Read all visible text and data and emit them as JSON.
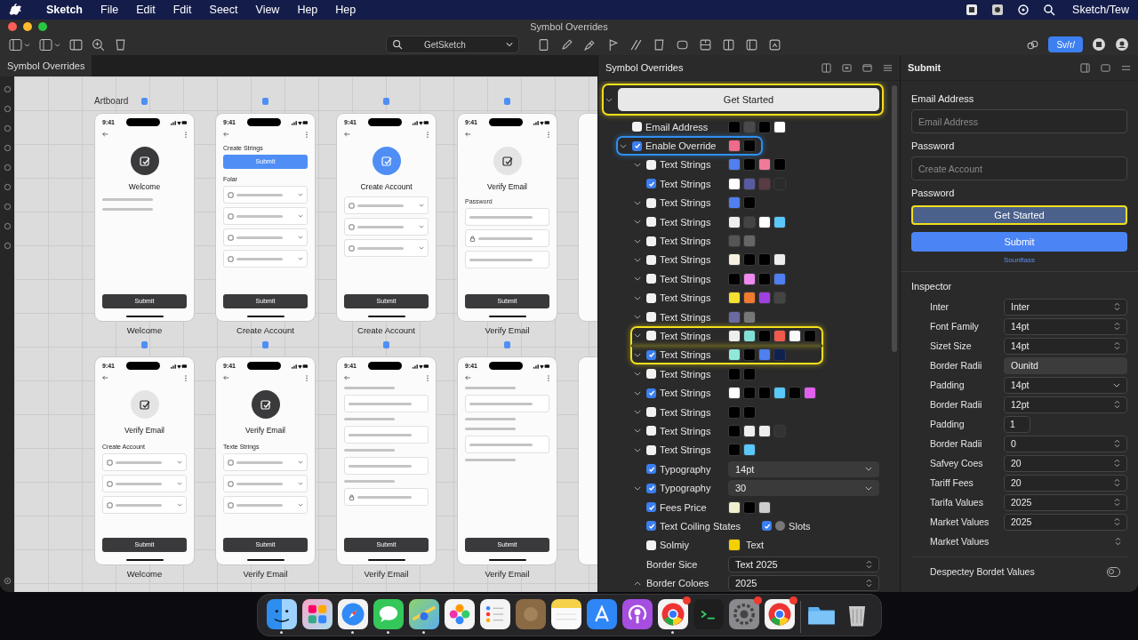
{
  "menubar": {
    "app": "Sketch",
    "menus": [
      "File",
      "Edit",
      "Fdit",
      "Seect",
      "View",
      "Hep",
      "Hep"
    ],
    "status_text": "Sketch/Tew"
  },
  "window": {
    "title": "Symbol Overrides",
    "search": {
      "value": "GetSketch"
    },
    "toolbar_button": "Sv/r/"
  },
  "canvas": {
    "tab": "Symbol Overrides",
    "artboard_label": "Artboard",
    "rows": [
      [
        {
          "caption": "Welcome",
          "time": "9:41",
          "blocks": [
            {
              "kind": "avatar",
              "color": "#3a3a3c"
            },
            {
              "kind": "title",
              "text": "Welcome"
            },
            {
              "kind": "scribble"
            },
            {
              "kind": "scribble"
            },
            {
              "kind": "button",
              "text": "Submit"
            }
          ]
        },
        {
          "caption": "Create Account",
          "time": "9:41",
          "blocks": [
            {
              "kind": "heading",
              "text": "Create Strings"
            },
            {
              "kind": "primary",
              "text": "Submit"
            },
            {
              "kind": "heading",
              "text": "Folar"
            },
            {
              "kind": "select"
            },
            {
              "kind": "select"
            },
            {
              "kind": "select"
            },
            {
              "kind": "select"
            },
            {
              "kind": "button",
              "text": "Submit"
            }
          ]
        },
        {
          "caption": "Create Account",
          "time": "9:41",
          "blocks": [
            {
              "kind": "avatar",
              "color": "#4f8ff5"
            },
            {
              "kind": "title",
              "text": "Create Account"
            },
            {
              "kind": "select"
            },
            {
              "kind": "select"
            },
            {
              "kind": "select"
            },
            {
              "kind": "button",
              "text": "Submit"
            }
          ]
        },
        {
          "caption": "Verify Email",
          "time": "9:41",
          "blocks": [
            {
              "kind": "avatar",
              "color": "#e4e4e4"
            },
            {
              "kind": "title",
              "text": "Verify Email"
            },
            {
              "kind": "label",
              "text": "Password"
            },
            {
              "kind": "field",
              "icon": false
            },
            {
              "kind": "field",
              "icon": true
            },
            {
              "kind": "field",
              "icon": false
            },
            {
              "kind": "button",
              "text": "Submit"
            }
          ]
        }
      ],
      [
        {
          "caption": "Welcome",
          "time": "9:41",
          "blocks": [
            {
              "kind": "avatar",
              "color": "#e4e4e4"
            },
            {
              "kind": "title",
              "text": "Verify Email"
            },
            {
              "kind": "heading",
              "text": "Create Account"
            },
            {
              "kind": "select"
            },
            {
              "kind": "select"
            },
            {
              "kind": "select"
            },
            {
              "kind": "button",
              "text": "Submit"
            }
          ]
        },
        {
          "caption": "Verify Email",
          "time": "9:41",
          "blocks": [
            {
              "kind": "avatar",
              "color": "#3a3a3c"
            },
            {
              "kind": "title",
              "text": "Verify Email"
            },
            {
              "kind": "heading",
              "text": "Texte Strings"
            },
            {
              "kind": "select"
            },
            {
              "kind": "select"
            },
            {
              "kind": "select"
            },
            {
              "kind": "button",
              "text": "Submit"
            }
          ]
        },
        {
          "caption": "Verify Email",
          "time": "9:41",
          "blocks": [
            {
              "kind": "scribble"
            },
            {
              "kind": "field",
              "icon": false
            },
            {
              "kind": "scribble"
            },
            {
              "kind": "field",
              "icon": false
            },
            {
              "kind": "scribble"
            },
            {
              "kind": "field",
              "icon": false
            },
            {
              "kind": "scribble"
            },
            {
              "kind": "field",
              "icon": true
            },
            {
              "kind": "button",
              "text": "Submit"
            }
          ]
        },
        {
          "caption": "Verify Email",
          "time": "9:41",
          "blocks": [
            {
              "kind": "scribble"
            },
            {
              "kind": "field",
              "icon": false
            },
            {
              "kind": "scribble"
            },
            {
              "kind": "scribble"
            },
            {
              "kind": "field",
              "icon": false
            },
            {
              "kind": "scribble"
            },
            {
              "kind": "button",
              "text": "Submit"
            }
          ]
        }
      ]
    ]
  },
  "overrides": {
    "title": "Symbol Overrides",
    "items": [
      {
        "kind": "button",
        "label": "Get Started",
        "expanded": true,
        "highlight": {
          "color": "#f2df1c"
        },
        "children": [
          {
            "kind": "swatches",
            "label": "Email Address",
            "checked": false,
            "swatches": [
              {
                "color": "#000000"
              },
              {
                "color": "#4a4a4a"
              },
              {
                "color": "#000000"
              },
              {
                "color": "#ffffff"
              }
            ]
          },
          {
            "kind": "swatches",
            "label": "Enable Override",
            "checked": true,
            "expanded": true,
            "highlight": {
              "color": "#2f8ff0"
            },
            "swatches": [
              {
                "color": "#f06a8a"
              },
              {
                "color": "#000000"
              }
            ],
            "children": [
              {
                "kind": "swatches",
                "label": "Text Strings",
                "checked": false,
                "expanded": true,
                "swatches": [
                  {
                    "color": "#4f7ff0"
                  },
                  {
                    "color": "#000000"
                  },
                  {
                    "color": "#f07a9a"
                  },
                  {
                    "color": "#000000"
                  }
                ]
              },
              {
                "kind": "swatches",
                "label": "Text Strings",
                "checked": true,
                "swatches": [
                  {
                    "color": "#ffffff"
                  },
                  {
                    "color": "#5a5aa0"
                  },
                  {
                    "color": "#5a3a44"
                  },
                  {
                    "color": "#2a2a2a"
                  }
                ]
              },
              {
                "kind": "swatches",
                "label": "Text Strings",
                "checked": false,
                "expanded": true,
                "swatches": [
                  {
                    "color": "#4f7ff0"
                  },
                  {
                    "color": "#000000"
                  }
                ]
              },
              {
                "kind": "swatches",
                "label": "Text Strings",
                "checked": false,
                "expanded": true,
                "swatches": [
                  {
                    "color": "#eeeeee"
                  },
                  {
                    "color": "#444444"
                  },
                  {
                    "color": "#ffffff"
                  },
                  {
                    "color": "#5ac8fa"
                  }
                ]
              },
              {
                "kind": "swatches",
                "label": "Text Strings",
                "checked": false,
                "expanded": true,
                "swatches": [
                  {
                    "color": "#555555"
                  },
                  {
                    "color": "#666666"
                  }
                ]
              },
              {
                "kind": "swatches",
                "label": "Text Strings",
                "checked": false,
                "expanded": true,
                "swatches": [
                  {
                    "color": "#f5f0e0"
                  },
                  {
                    "color": "#000000"
                  },
                  {
                    "color": "#000000"
                  },
                  {
                    "color": "#eeeeee"
                  }
                ]
              },
              {
                "kind": "swatches",
                "label": "Text Strings",
                "checked": false,
                "expanded": true,
                "swatches": [
                  {
                    "color": "#000000"
                  },
                  {
                    "color": "#f08af0"
                  },
                  {
                    "color": "#000000"
                  },
                  {
                    "color": "#4f7ff0"
                  }
                ]
              },
              {
                "kind": "swatches",
                "label": "Text Strings",
                "checked": false,
                "expanded": true,
                "swatches": [
                  {
                    "color": "#f5e030"
                  },
                  {
                    "color": "#f07a30"
                  },
                  {
                    "color": "#a040e0"
                  },
                  {
                    "color": "#444444"
                  }
                ]
              },
              {
                "kind": "swatches",
                "label": "Text Strings",
                "checked": false,
                "expanded": true,
                "swatches": [
                  {
                    "color": "#6a6aa0"
                  },
                  {
                    "color": "#777777"
                  }
                ]
              },
              {
                "kind": "swatches",
                "label": "Text Strings",
                "checked": false,
                "expanded": true,
                "highlight": {
                  "color": "#f2df1c"
                },
                "swatches": [
                  {
                    "color": "#eeeeee"
                  },
                  {
                    "color": "#80e0d8"
                  },
                  {
                    "color": "#000000"
                  },
                  {
                    "color": "#f05a4a"
                  },
                  {
                    "color": "#fafafa"
                  },
                  {
                    "color": "#000000"
                  }
                ]
              },
              {
                "kind": "swatches",
                "label": "Text Strings",
                "checked": true,
                "expanded": true,
                "highlight": {
                  "color": "#f2df1c"
                },
                "swatches": [
                  {
                    "color": "#90e8d8"
                  },
                  {
                    "color": "#000000"
                  },
                  {
                    "color": "#4f7ff0"
                  },
                  {
                    "color": "#102050"
                  }
                ]
              },
              {
                "kind": "swatches",
                "label": "Text Strings",
                "checked": false,
                "expanded": true,
                "swatches": [
                  {
                    "color": "#000000"
                  },
                  {
                    "color": "#000000"
                  }
                ]
              },
              {
                "kind": "swatches",
                "label": "Text Strings",
                "checked": true,
                "expanded": true,
                "swatches": [
                  {
                    "color": "#ffffff"
                  },
                  {
                    "color": "#000000"
                  },
                  {
                    "color": "#000000"
                  },
                  {
                    "color": "#5ac8fa"
                  },
                  {
                    "color": "#000000"
                  },
                  {
                    "color": "#e060f0"
                  }
                ]
              },
              {
                "kind": "swatches",
                "label": "Text Strings",
                "checked": false,
                "expanded": true,
                "swatches": [
                  {
                    "color": "#000000"
                  },
                  {
                    "color": "#000000"
                  }
                ]
              },
              {
                "kind": "swatches",
                "label": "Text Strings",
                "checked": false,
                "expanded": true,
                "swatches": [
                  {
                    "color": "#000000"
                  },
                  {
                    "color": "#eeeeee"
                  },
                  {
                    "color": "#eeeeee"
                  },
                  {
                    "color": "#333333"
                  }
                ]
              },
              {
                "kind": "swatches",
                "label": "Text Strings",
                "checked": false,
                "expanded": true,
                "swatches": [
                  {
                    "color": "#000000"
                  },
                  {
                    "color": "#5ac8fa"
                  }
                ]
              },
              {
                "kind": "select",
                "label": "Typography",
                "checked": true,
                "value": "14pt"
              },
              {
                "kind": "select",
                "label": "Typography",
                "checked": true,
                "expanded": true,
                "value": "30"
              },
              {
                "kind": "swatches",
                "label": "Fees Price",
                "checked": true,
                "swatches": [
                  {
                    "color": "#f0f0d0"
                  },
                  {
                    "color": "#000000"
                  },
                  {
                    "color": "#cccccc"
                  }
                ]
              },
              {
                "kind": "double",
                "label": "Text Coiling States",
                "checked": true,
                "second": {
                  "label": "Slots",
                  "checked": true
                }
              },
              {
                "kind": "color-text",
                "label": "Solmiy",
                "checked": false,
                "color": "#f5d000",
                "text": "Text"
              },
              {
                "kind": "stepper",
                "label": "Border Sice",
                "value": "Text 2025"
              },
              {
                "kind": "stepper",
                "label": "Border Coloes",
                "expanded": false,
                "value": "2025"
              }
            ]
          }
        ]
      }
    ]
  },
  "form": {
    "title": "Submit",
    "fields": [
      {
        "label": "Email Address",
        "placeholder": "Email Address"
      },
      {
        "label": "Password",
        "placeholder": "Create Account"
      }
    ],
    "buttons_label": "Password",
    "buttons": [
      {
        "label": "Get Started",
        "kind": "secondary",
        "highlight": {
          "color": "#f2df1c"
        }
      },
      {
        "label": "Submit",
        "kind": "primary"
      }
    ],
    "link": "Sounflass"
  },
  "inspector": {
    "title": "Inspector",
    "rows": [
      {
        "label": "Inter",
        "kind": "stepper",
        "value": "Inter"
      },
      {
        "label": "Font Family",
        "kind": "stepper",
        "value": "14pt"
      },
      {
        "label": "Sizet Size",
        "kind": "stepper",
        "value": "14pt"
      },
      {
        "label": "Border Radii",
        "kind": "plain",
        "value": "Ounitd"
      },
      {
        "label": "Padding",
        "kind": "dropdown",
        "value": "14pt"
      },
      {
        "label": "Border Radii",
        "kind": "stepper",
        "value": "12pt"
      },
      {
        "label": "Padding",
        "kind": "number",
        "value": "1"
      },
      {
        "label": "Border Radii",
        "kind": "stepper",
        "value": "0"
      },
      {
        "label": "Safvey Coes",
        "kind": "stepper",
        "value": "20"
      },
      {
        "label": "Tariff Fees",
        "kind": "stepper",
        "value": "20"
      },
      {
        "label": "Tarifa Values",
        "kind": "stepper",
        "value": "2025"
      },
      {
        "label": "Market Values",
        "kind": "stepper",
        "value": "2025"
      },
      {
        "label": "Market Values",
        "kind": "arrows"
      }
    ],
    "toggle": {
      "label": "Despectey Bordet Values",
      "on": false
    }
  },
  "dock": [
    {
      "kind": "finder",
      "running": true,
      "badge": false
    },
    {
      "kind": "launchpad",
      "running": false,
      "badge": false
    },
    {
      "kind": "safari",
      "running": true,
      "badge": false
    },
    {
      "kind": "messages",
      "running": true,
      "badge": false
    },
    {
      "kind": "maps",
      "running": true,
      "badge": false
    },
    {
      "kind": "photos",
      "running": false,
      "badge": false
    },
    {
      "kind": "reminders",
      "running": false,
      "badge": false
    },
    {
      "kind": "brown",
      "running": false,
      "badge": false
    },
    {
      "kind": "notes",
      "running": false,
      "badge": false
    },
    {
      "kind": "appstore",
      "running": false,
      "badge": false
    },
    {
      "kind": "podcasts",
      "running": false,
      "badge": false
    },
    {
      "kind": "chrome",
      "running": true,
      "badge": true
    },
    {
      "kind": "terminal",
      "running": false,
      "badge": false
    },
    {
      "kind": "settings",
      "running": false,
      "badge": true
    },
    {
      "kind": "chrome",
      "running": false,
      "badge": true
    },
    {
      "kind": "folder",
      "running": false,
      "badge": false
    },
    {
      "kind": "trash",
      "running": false,
      "badge": false
    }
  ]
}
